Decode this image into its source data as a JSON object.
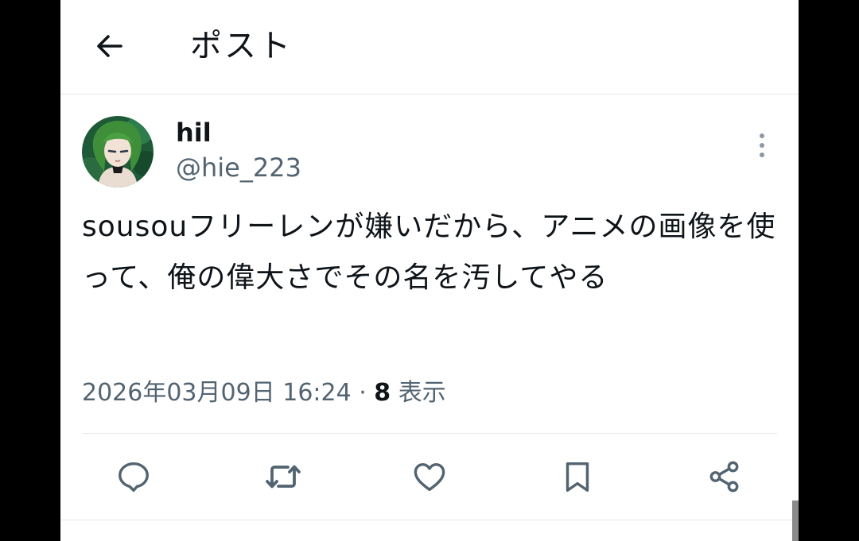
{
  "header": {
    "title": "ポスト",
    "back_icon": "arrow-left-icon"
  },
  "post": {
    "author": {
      "display_name": "hil",
      "handle": "@hie_223",
      "avatar_icon": "avatar-image"
    },
    "more_icon": "more-vertical-icon",
    "text": "sousouフリーレンが嫌いだから、アニメの画像を使って、俺の偉大さでその名を汚してやる",
    "timestamp": "2026年03月09日 16:24",
    "separator": " · ",
    "views_count": "8",
    "views_label": " 表示"
  },
  "actions": [
    {
      "name": "reply",
      "icon": "reply-icon"
    },
    {
      "name": "repost",
      "icon": "repost-icon"
    },
    {
      "name": "like",
      "icon": "heart-icon"
    },
    {
      "name": "bookmark",
      "icon": "bookmark-icon"
    },
    {
      "name": "share",
      "icon": "share-icon"
    }
  ],
  "colors": {
    "text_primary": "#0f1419",
    "text_secondary": "#536471",
    "icon": "#536471",
    "divider": "#e5e8ec",
    "outside_background": "#000000"
  }
}
